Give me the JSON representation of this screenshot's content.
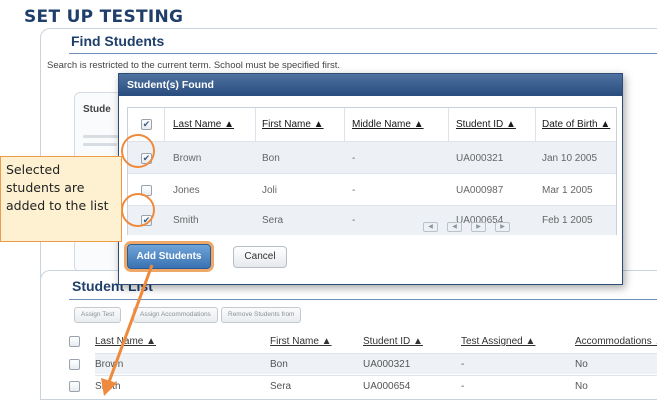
{
  "page_title": "SET UP TESTING",
  "find_students": {
    "title": "Find Students",
    "note": "Search is restricted to the current term. School must be specified first.",
    "inner_title": "Stude"
  },
  "modal": {
    "title": "Student(s) Found",
    "columns": [
      "Last Name ▲",
      "First Name ▲",
      "Middle Name ▲",
      "Student ID ▲",
      "Date of Birth ▲"
    ],
    "rows": [
      {
        "checked": true,
        "last": "Brown",
        "first": "Bon",
        "middle": "-",
        "id": "UA000321",
        "dob": "Jan 10 2005"
      },
      {
        "checked": false,
        "last": "Jones",
        "first": "Joli",
        "middle": "-",
        "id": "UA000987",
        "dob": "Mar 1 2005"
      },
      {
        "checked": true,
        "last": "Smith",
        "first": "Sera",
        "middle": "-",
        "id": "UA000654",
        "dob": "Feb 1 2005"
      }
    ],
    "pager": [
      "◀",
      "◀",
      "▶",
      "▶"
    ],
    "add_label": "Add Students",
    "cancel_label": "Cancel"
  },
  "student_list": {
    "title": "Student List",
    "buttons": [
      "Assign Test",
      "Assign Accommodations",
      "Remove Students from"
    ],
    "columns": [
      "Last Name ▲",
      "First Name ▲",
      "Student ID ▲",
      "Test Assigned ▲",
      "Accommodations ▲"
    ],
    "rows": [
      {
        "last": "Brown",
        "first": "Bon",
        "id": "UA000321",
        "test": "-",
        "accom": "No"
      },
      {
        "last": "Smith",
        "first": "Sera",
        "id": "UA000654",
        "test": "-",
        "accom": "No"
      }
    ]
  },
  "callout": {
    "text": "Selected students are added to the list"
  },
  "colors": {
    "accent": "#ef8a3c",
    "title_blue": "#1f3f6b",
    "modal_bar": "#284c7d",
    "callout_bg": "#fdf1d1"
  },
  "icons": [
    "checkbox-checked-icon",
    "checkbox-empty-icon",
    "sort-ascending-icon",
    "pager-prev-icon",
    "pager-next-icon",
    "arrow-icon"
  ]
}
